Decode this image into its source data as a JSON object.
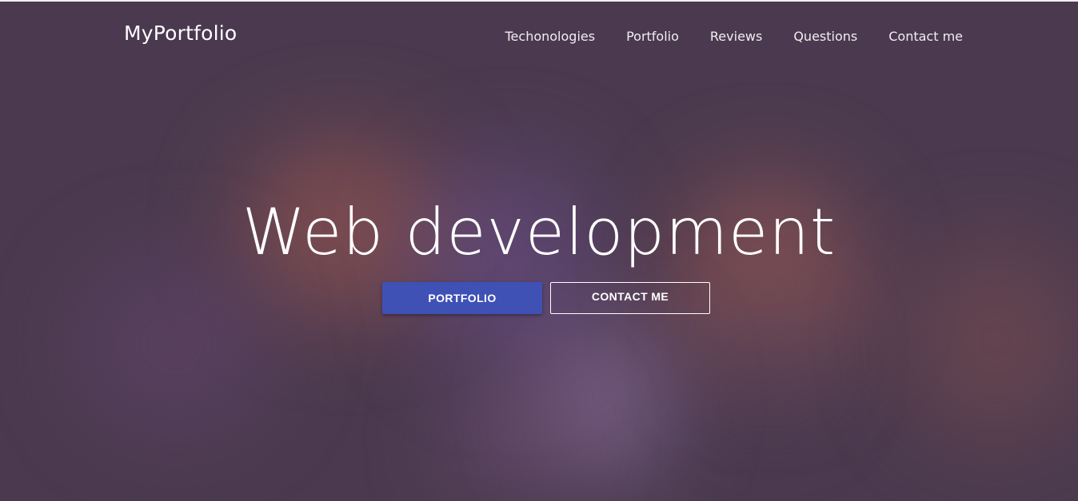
{
  "header": {
    "brand": "MyPortfolio",
    "nav": [
      {
        "label": "Techonologies"
      },
      {
        "label": "Portfolio"
      },
      {
        "label": "Reviews"
      },
      {
        "label": "Questions"
      },
      {
        "label": "Contact me"
      }
    ]
  },
  "hero": {
    "title": "Web development",
    "primary_button": "PORTFOLIO",
    "secondary_button": "CONTACT ME"
  },
  "colors": {
    "background": "#4b3a4f",
    "accent": "#3f51b5",
    "text": "#ffffff"
  }
}
